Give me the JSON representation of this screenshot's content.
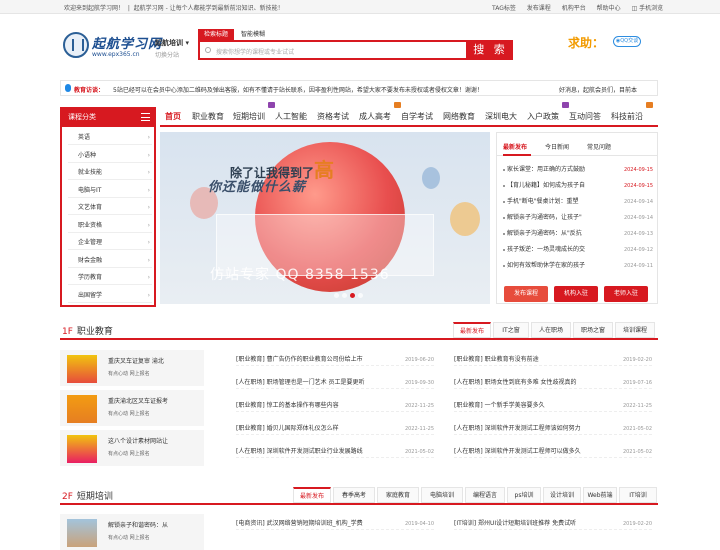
{
  "topbar": {
    "welcome": "欢迎来到起航学习网！",
    "slogan": "起航学习网 - 让每个人都能学到最新前沿知识、新技能！",
    "links": [
      "TAG标签",
      "发布课程",
      "机构平台",
      "帮助中心",
      "手机浏览"
    ]
  },
  "header": {
    "logo_text": "起航学习网",
    "logo_url": "www.epx365.cn",
    "city": "起航培训",
    "city_sub": "切换分站",
    "search_tabs": [
      "检索标题",
      "智能模糊"
    ],
    "search_placeholder": "搜索你想学的课程或专业试试",
    "search_button": "搜 索",
    "help_label": "求助：",
    "qq_label": "QQ交谈"
  },
  "notice": {
    "label": "教育访谈：",
    "text": "5站已经可以在会员中心添加二维码及弹出客服，如有不懂请于站长联系，因非盈利性网站，希望大家不要发布未授权或者侵权文章！谢谢！",
    "text2": "好消息，起航会员们，目前本"
  },
  "nav": {
    "category_title": "课程分类",
    "items": [
      "首页",
      "职业教育",
      "短期培训",
      "人工智能",
      "资格考试",
      "成人高考",
      "自学考试",
      "网络教育",
      "深圳电大",
      "入户政策",
      "互动问答",
      "科技前沿"
    ]
  },
  "categories": [
    "英语",
    "小语种",
    "就业技能",
    "电脑与IT",
    "文艺体育",
    "职业资格",
    "企业管理",
    "财会金融",
    "学历教育",
    "出国留学"
  ],
  "banner": {
    "headline1": "除了让我得到了",
    "headline1_big": "高",
    "headline2": "你还能做什么薪",
    "watermark": "仿站专家 QQ 8358 1536"
  },
  "news": {
    "tabs": [
      "最新发布",
      "今日新闻",
      "常见问题"
    ],
    "items": [
      {
        "title": "家长课堂：用正确的方式鼓励",
        "date": "2024-09-15",
        "hot": true
      },
      {
        "title": "【育儿秘籍】如何成为孩子自",
        "date": "2024-09-15",
        "hot": true
      },
      {
        "title": "手机\"断电\"餐桌计划：重塑",
        "date": "2024-09-14",
        "hot": false
      },
      {
        "title": "解锁亲子沟通密码，让孩子\"",
        "date": "2024-09-14",
        "hot": false
      },
      {
        "title": "解锁亲子沟通密码：从\"反抗",
        "date": "2024-09-13",
        "hot": false
      },
      {
        "title": "孩子叛逆：一场灵魂成长的交",
        "date": "2024-09-12",
        "hot": false
      },
      {
        "title": "如何有效帮助休学在家的孩子",
        "date": "2024-09-11",
        "hot": false
      }
    ],
    "buttons": [
      "发布课程",
      "机构入驻",
      "老师入驻"
    ],
    "button_colors": [
      "#e74c3c",
      "#d71920",
      "#d71920"
    ]
  },
  "section1": {
    "num": "1F",
    "title": "职业教育",
    "tabs": [
      "最新发布",
      "IT之窗",
      "人在职场",
      "职场之窗",
      "培训课程"
    ],
    "cards": [
      {
        "title": "重庆叉车证复审 渝北",
        "sub": "有点心动 网上报名"
      },
      {
        "title": "重庆渝北区叉车证报考",
        "sub": "有点心动 网上报名"
      },
      {
        "title": "这八个设计素材网站让",
        "sub": "有点心动 网上报名"
      }
    ],
    "left_rows": [
      {
        "title": "[职业教育] 曹广告仍作的职业教育公司份给上市",
        "date": "2019-06-20"
      },
      {
        "title": "[人在职场] 职场管理也是一门艺术 员工是要更听",
        "date": "2019-09-30"
      },
      {
        "title": "[职业教育] 惊工的基本操作有哪些内容",
        "date": "2022-11-25"
      },
      {
        "title": "[职业教育] 婚贝儿国际郑体礼仪怎么样",
        "date": "2022-11-25"
      },
      {
        "title": "[人在职场] 深圳软件开发测试职业行业发展路线",
        "date": "2021-05-02"
      }
    ],
    "right_rows": [
      {
        "title": "[职业教育] 职业教育有没有前途",
        "date": "2019-02-20"
      },
      {
        "title": "[人在职场] 职场女性到底有多难 女性歧视真的",
        "date": "2019-07-16"
      },
      {
        "title": "[职业教育] 一个新手学美容要多久",
        "date": "2022-11-25"
      },
      {
        "title": "[人在职场] 深圳软件开发测试工程师该如何努力",
        "date": "2021-05-02"
      },
      {
        "title": "[人在职场] 深圳软件开发测试工程师可以做多久",
        "date": "2021-05-02"
      }
    ]
  },
  "section2": {
    "num": "2F",
    "title": "短期培训",
    "tabs": [
      "最新发布",
      "春季高考",
      "家庭教育",
      "电脑培训",
      "编程语言",
      "ps培训",
      "设计培训",
      "Web前端",
      "IT培训"
    ],
    "cards": [
      {
        "title": "解锁亲子和谐密码：从",
        "sub": "有点心动 网上报名"
      }
    ],
    "left_rows": [
      {
        "title": "[电商资讯] 武汉网络营销短期培训班_机构_学费",
        "date": "2019-04-10"
      }
    ],
    "right_rows": [
      {
        "title": "[IT培训] 郑州UI设计短期培训班推荐 免费试听",
        "date": "2019-02-20"
      }
    ]
  },
  "colors": {
    "brand": "#d71920",
    "logo": "#1d4f91",
    "help": "#f29b00",
    "qq": "#2d8de0"
  }
}
